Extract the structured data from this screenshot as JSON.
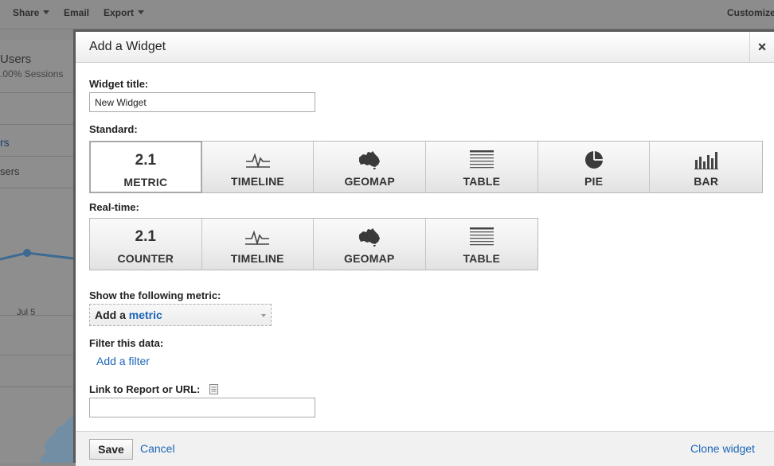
{
  "background": {
    "toolbar": {
      "share": "Share",
      "email": "Email",
      "export": "Export",
      "customize": "Customize"
    },
    "users_label": "Users",
    "sessions_label": ".00% Sessions",
    "rs_label": "rs",
    "sers_label": "sers",
    "x_tick": "Jul 5"
  },
  "dialog": {
    "title": "Add a Widget",
    "close_label": "×",
    "widget_title_label": "Widget title:",
    "widget_title_value": "New Widget",
    "standard_label": "Standard:",
    "standard_types": [
      {
        "label": "METRIC",
        "icon": "metric-icon",
        "icon_text": "2.1",
        "selected": true
      },
      {
        "label": "TIMELINE",
        "icon": "timeline-icon"
      },
      {
        "label": "GEOMAP",
        "icon": "geomap-icon"
      },
      {
        "label": "TABLE",
        "icon": "table-icon"
      },
      {
        "label": "PIE",
        "icon": "pie-icon"
      },
      {
        "label": "BAR",
        "icon": "bar-icon"
      }
    ],
    "realtime_label": "Real-time:",
    "realtime_types": [
      {
        "label": "COUNTER",
        "icon": "counter-icon",
        "icon_text": "2.1"
      },
      {
        "label": "TIMELINE",
        "icon": "timeline-icon"
      },
      {
        "label": "GEOMAP",
        "icon": "geomap-icon"
      },
      {
        "label": "TABLE",
        "icon": "table-icon"
      }
    ],
    "metric_label": "Show the following metric:",
    "metric_select_prefix": "Add a",
    "metric_select_link": "metric",
    "filter_label": "Filter this data:",
    "add_filter": "Add a filter",
    "link_label": "Link to Report or URL:",
    "link_value": "",
    "save": "Save",
    "cancel": "Cancel",
    "clone": "Clone widget"
  },
  "colors": {
    "link": "#1a65b8",
    "overlay": "#8a8a8a"
  }
}
